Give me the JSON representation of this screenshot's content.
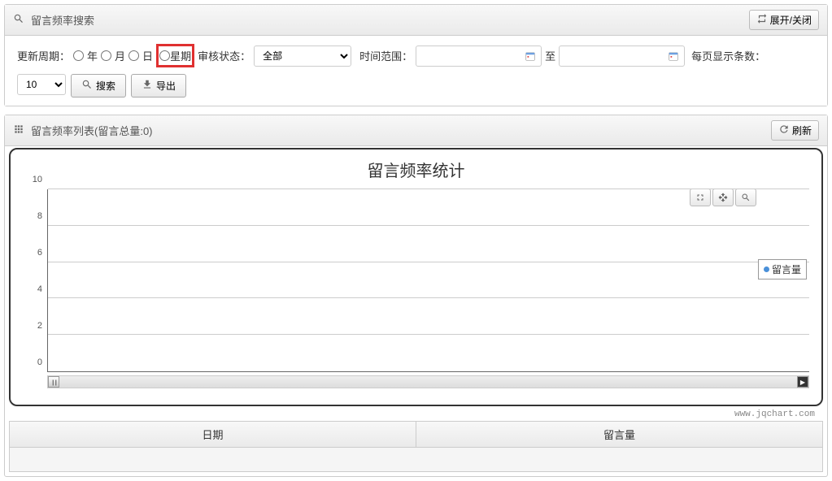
{
  "search_panel": {
    "title": "留言频率搜索",
    "toggle_btn": "展开/关闭",
    "filters": {
      "update_cycle_label": "更新周期：",
      "radio_year": "年",
      "radio_month": "月",
      "radio_day": "日",
      "radio_week": "星期",
      "status_label": "审核状态：",
      "status_options": [
        "全部"
      ],
      "status_selected": "全部",
      "time_range_label": "时间范围：",
      "time_to": "至",
      "per_page_label": "每页显示条数：",
      "per_page_options": [
        "10"
      ],
      "per_page_selected": "10",
      "search_btn": "搜索",
      "export_btn": "导出"
    }
  },
  "list_panel": {
    "title": "留言频率列表(留言总量:0)",
    "refresh_btn": "刷新"
  },
  "chart_data": {
    "type": "line",
    "title": "留言频率统计",
    "categories": [],
    "series": [
      {
        "name": "留言量",
        "values": []
      }
    ],
    "ylim": [
      0,
      10
    ],
    "yticks": [
      0,
      2,
      4,
      6,
      8,
      10
    ],
    "xlabel": "",
    "ylabel": "",
    "legend": "留言量",
    "watermark": "www.jqchart.com"
  },
  "table": {
    "columns": [
      "日期",
      "留言量"
    ],
    "rows": []
  }
}
